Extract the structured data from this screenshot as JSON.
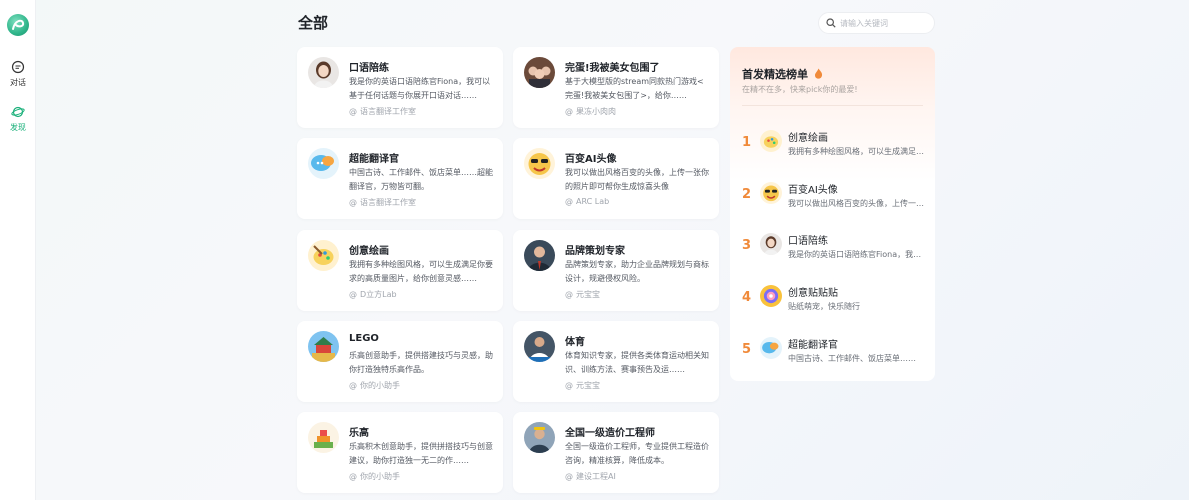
{
  "sidebar": {
    "items": [
      {
        "label": "对话",
        "icon": "chat-icon"
      },
      {
        "label": "发现",
        "icon": "discover-icon"
      }
    ]
  },
  "header": {
    "title": "全部",
    "search_placeholder": "请输入关键词"
  },
  "cards": [
    {
      "title": "口语陪练",
      "desc": "我是你的英语口语陪练官Fiona，我可以基于任何话题与你展开口语对话……",
      "author": "语言翻译工作室",
      "icon": "woman-avatar"
    },
    {
      "title": "完蛋!我被美女包围了",
      "desc": "基于大模型版的stream同款热门游戏<完蛋!我被美女包围了>，给你……",
      "author": "果冻小肉肉",
      "icon": "group-avatar"
    },
    {
      "title": "超能翻译官",
      "desc": "中国古诗、工作邮件、饭店菜单……超能翻译官，万物皆可翻。",
      "author": "语言翻译工作室",
      "icon": "speech-bubble-avatar"
    },
    {
      "title": "百变AI头像",
      "desc": "我可以做出风格百变的头像，上传一张你的照片即可帮你生成惊喜头像",
      "author": "ARC Lab",
      "icon": "cool-emoji-avatar"
    },
    {
      "title": "创意绘画",
      "desc": "我拥有多种绘图风格，可以生成满足你要求的高质量图片，给你创意灵感……",
      "author": "D立方Lab",
      "icon": "paint-avatar"
    },
    {
      "title": "品牌策划专家",
      "desc": "品牌策划专家，助力企业品牌规划与商标设计，规避侵权风险。",
      "author": "元宝宝",
      "icon": "businessman-avatar"
    },
    {
      "title": "LEGO",
      "desc": "乐高创意助手，提供搭建技巧与灵感，助你打造独特乐高作品。",
      "author": "你的小助手",
      "icon": "lego-temple-avatar"
    },
    {
      "title": "体育",
      "desc": "体育知识专家，提供各类体育运动相关知识、训练方法、赛事预告及运……",
      "author": "元宝宝",
      "icon": "sports-avatar"
    },
    {
      "title": "乐高",
      "desc": "乐高积木创意助手，提供拼搭技巧与创意建议，助你打造独一无二的作……",
      "author": "你的小助手",
      "icon": "lego-blocks-avatar"
    },
    {
      "title": "全国一级造价工程师",
      "desc": "全国一级造价工程师，专业提供工程造价咨询，精准核算，降低成本。",
      "author": "建设工程AI",
      "icon": "engineer-avatar"
    }
  ],
  "ranking": {
    "title": "首发精选榜单",
    "subtitle": "在精不在多，快来pick你的最爱!",
    "accent": "#f08a3a",
    "items": [
      {
        "rank": "1",
        "name": "创意绘画",
        "desc": "我拥有多种绘图风格，可以生成满足你要求的高质量图片",
        "icon": "paint-avatar"
      },
      {
        "rank": "2",
        "name": "百变AI头像",
        "desc": "我可以做出风格百变的头像，上传一张你的照片即可",
        "icon": "cool-emoji-avatar"
      },
      {
        "rank": "3",
        "name": "口语陪练",
        "desc": "我是你的英语口语陪练官Fiona，我可以基于任何话题",
        "icon": "woman-avatar"
      },
      {
        "rank": "4",
        "name": "创意贴贴贴",
        "desc": "贴纸萌宠，快乐随行",
        "icon": "sticker-avatar"
      },
      {
        "rank": "5",
        "name": "超能翻译官",
        "desc": "中国古诗、工作邮件、饭店菜单……",
        "icon": "speech-bubble-avatar"
      }
    ]
  }
}
